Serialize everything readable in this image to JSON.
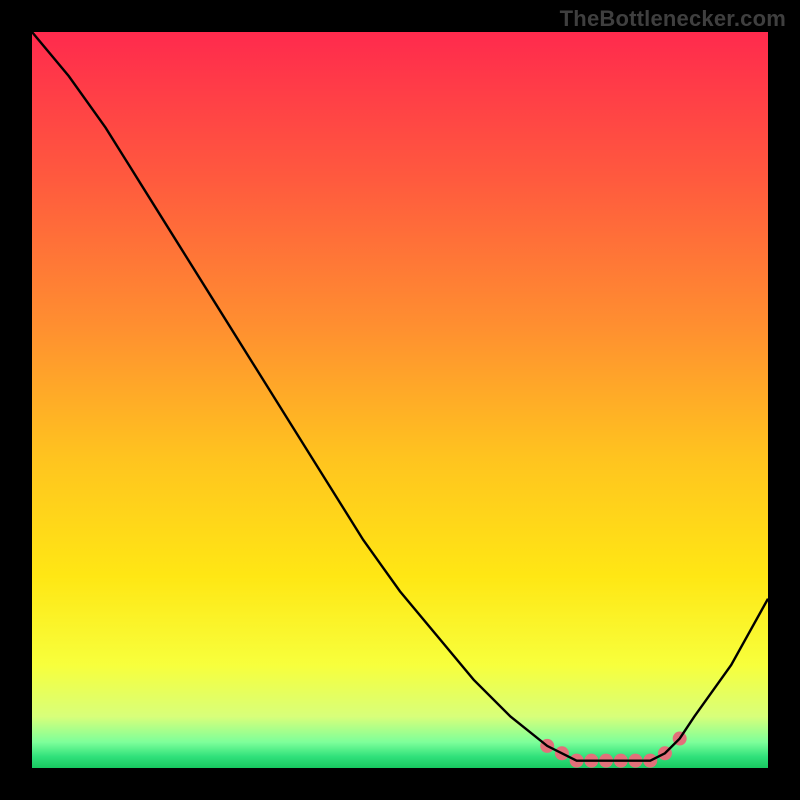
{
  "watermark": "TheBottlenecker.com",
  "chart_data": {
    "type": "line",
    "title": "",
    "xlabel": "",
    "ylabel": "",
    "xlim": [
      0,
      100
    ],
    "ylim": [
      0,
      100
    ],
    "x": [
      0,
      5,
      10,
      15,
      20,
      25,
      30,
      35,
      40,
      45,
      50,
      55,
      60,
      65,
      70,
      72,
      74,
      76,
      78,
      80,
      82,
      84,
      86,
      88,
      90,
      95,
      100
    ],
    "values": [
      100,
      94,
      87,
      79,
      71,
      63,
      55,
      47,
      39,
      31,
      24,
      18,
      12,
      7,
      3,
      2,
      1,
      1,
      1,
      1,
      1,
      1,
      2,
      4,
      7,
      14,
      23
    ],
    "highlight_range_x": [
      70,
      88
    ],
    "gradient_stops": [
      {
        "offset": 0.0,
        "color": "#ff2a4d"
      },
      {
        "offset": 0.2,
        "color": "#ff5a3e"
      },
      {
        "offset": 0.4,
        "color": "#ff8f30"
      },
      {
        "offset": 0.58,
        "color": "#ffc41f"
      },
      {
        "offset": 0.74,
        "color": "#ffe714"
      },
      {
        "offset": 0.86,
        "color": "#f7ff3c"
      },
      {
        "offset": 0.93,
        "color": "#d8ff7a"
      },
      {
        "offset": 0.965,
        "color": "#7dff9a"
      },
      {
        "offset": 0.985,
        "color": "#2fe07a"
      },
      {
        "offset": 1.0,
        "color": "#18c860"
      }
    ],
    "highlight_marker": {
      "color": "#e2707a",
      "radius": 7
    }
  }
}
